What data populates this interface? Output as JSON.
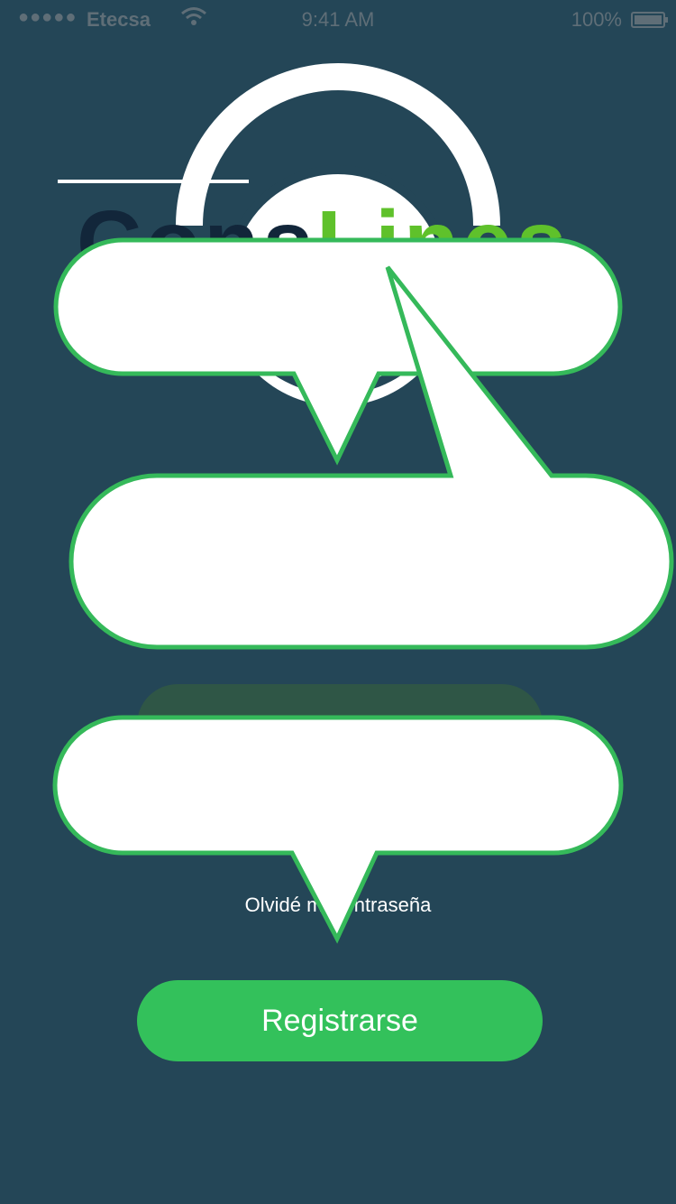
{
  "status_bar": {
    "signal": "●●●●●",
    "carrier": "Etecsa",
    "time": "9:41 AM",
    "battery_percent": "100%",
    "wifi_icon": "wifi-icon",
    "battery_icon": "battery-icon"
  },
  "logo": {
    "part1": "Cons",
    "part2": "Lines",
    "icon": "headphones-icon",
    "accent_color": "#5fc12b"
  },
  "actions": {
    "forgot_password": "Olvidé mi contraseña",
    "register": "Registrarse"
  },
  "colors": {
    "background": "#244657",
    "primary": "#33c15b",
    "bubble_border": "#35b95a"
  }
}
